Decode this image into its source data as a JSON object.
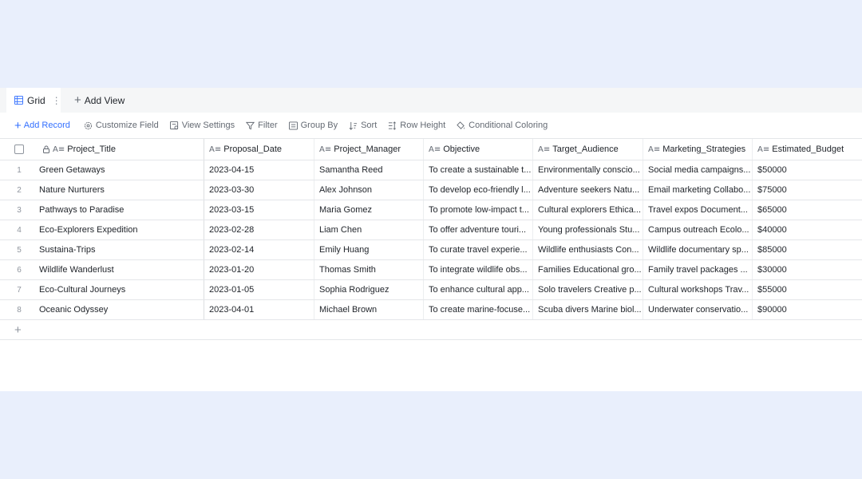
{
  "views": {
    "active_tab": "Grid",
    "add_view_label": "Add View"
  },
  "toolbar": {
    "add_record": "Add Record",
    "customize_field": "Customize Field",
    "view_settings": "View Settings",
    "filter": "Filter",
    "group_by": "Group By",
    "sort": "Sort",
    "row_height": "Row Height",
    "conditional_coloring": "Conditional Coloring"
  },
  "columns": [
    "Project_Title",
    "Proposal_Date",
    "Project_Manager",
    "Objective",
    "Target_Audience",
    "Marketing_Strategies",
    "Estimated_Budget"
  ],
  "rows": [
    {
      "index": "1",
      "title": "Green Getaways",
      "date": "2023-04-15",
      "manager": "Samantha Reed",
      "objective": "To create a sustainable t...",
      "audience": "Environmentally conscio...",
      "strategies": "Social media campaigns...",
      "budget": "$50000"
    },
    {
      "index": "2",
      "title": "Nature Nurturers",
      "date": "2023-03-30",
      "manager": "Alex Johnson",
      "objective": "To develop eco-friendly l...",
      "audience": "Adventure seekers Natu...",
      "strategies": "Email marketing Collabo...",
      "budget": "$75000"
    },
    {
      "index": "3",
      "title": "Pathways to Paradise",
      "date": "2023-03-15",
      "manager": "Maria Gomez",
      "objective": "To promote low-impact t...",
      "audience": "Cultural explorers Ethica...",
      "strategies": "Travel expos Document...",
      "budget": "$65000"
    },
    {
      "index": "4",
      "title": "Eco-Explorers Expedition",
      "date": "2023-02-28",
      "manager": "Liam Chen",
      "objective": "To offer adventure touri...",
      "audience": "Young professionals Stu...",
      "strategies": "Campus outreach Ecolo...",
      "budget": "$40000"
    },
    {
      "index": "5",
      "title": "Sustaina-Trips",
      "date": "2023-02-14",
      "manager": "Emily Huang",
      "objective": "To curate travel experie...",
      "audience": "Wildlife enthusiasts Con...",
      "strategies": "Wildlife documentary sp...",
      "budget": "$85000"
    },
    {
      "index": "6",
      "title": "Wildlife Wanderlust",
      "date": "2023-01-20",
      "manager": "Thomas Smith",
      "objective": "To integrate wildlife obs...",
      "audience": "Families Educational gro...",
      "strategies": "Family travel packages ...",
      "budget": "$30000"
    },
    {
      "index": "7",
      "title": "Eco-Cultural Journeys",
      "date": "2023-01-05",
      "manager": "Sophia Rodriguez",
      "objective": "To enhance cultural app...",
      "audience": "Solo travelers Creative p...",
      "strategies": "Cultural workshops Trav...",
      "budget": "$55000"
    },
    {
      "index": "8",
      "title": "Oceanic Odyssey",
      "date": "2023-04-01",
      "manager": "Michael Brown",
      "objective": "To create marine-focuse...",
      "audience": "Scuba divers Marine biol...",
      "strategies": "Underwater conservatio...",
      "budget": "$90000"
    }
  ],
  "colors": {
    "accent": "#3370ff",
    "background": "#e9effc",
    "panel": "#ffffff",
    "tabbar": "#f5f6f7"
  }
}
